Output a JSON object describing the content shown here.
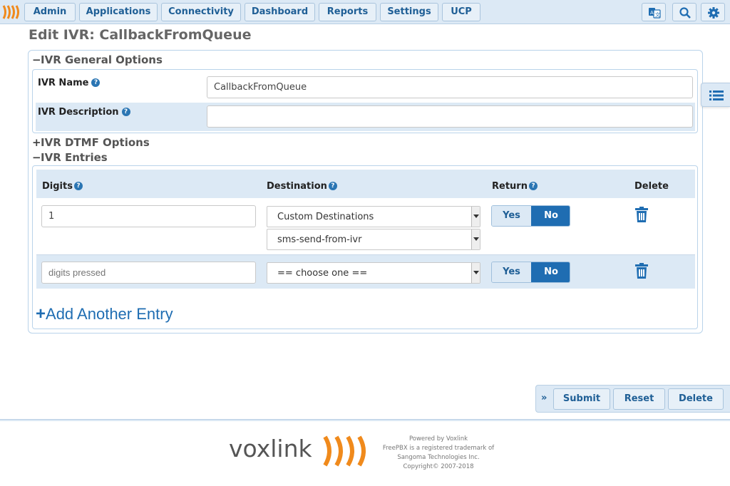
{
  "nav": {
    "items": [
      "Admin",
      "Applications",
      "Connectivity",
      "Dashboard",
      "Reports",
      "Settings",
      "UCP"
    ],
    "icons": [
      "language-icon",
      "search-icon",
      "gear-icon"
    ]
  },
  "page": {
    "title": "Edit IVR: CallbackFromQueue"
  },
  "general": {
    "section_title": "IVR General Options",
    "name_label": "IVR Name",
    "name_value": "CallbackFromQueue",
    "desc_label": "IVR Description",
    "desc_value": ""
  },
  "dtmf": {
    "section_title": "IVR DTMF Options"
  },
  "entries": {
    "section_title": "IVR Entries",
    "headers": {
      "digits": "Digits",
      "destination": "Destination",
      "return": "Return",
      "delete": "Delete"
    },
    "rows": [
      {
        "digits": "1",
        "destination": "Custom Destinations",
        "sub_destination": "sms-send-from-ivr",
        "yes": "Yes",
        "no": "No",
        "return_selected": "No"
      },
      {
        "digits_placeholder": "digits pressed",
        "destination": "== choose one ==",
        "yes": "Yes",
        "no": "No",
        "return_selected": "No"
      }
    ],
    "add_label": "Add Another Entry"
  },
  "actions": {
    "submit": "Submit",
    "reset": "Reset",
    "delete": "Delete",
    "toggle": "»"
  },
  "footer": {
    "brand": "voxlink",
    "lines": [
      "Powered by Voxlink",
      "FreePBX is a registered trademark of",
      "Sangoma Technologies Inc.",
      "Copyright© 2007-2018"
    ]
  },
  "colors": {
    "accent": "#1f6db2",
    "nav_bg": "#dce9f5",
    "brand_orange": "#f08a1c"
  }
}
